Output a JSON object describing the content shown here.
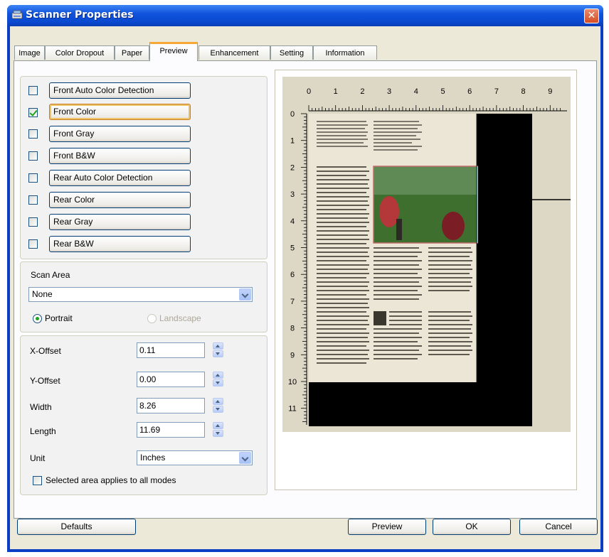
{
  "window": {
    "title": "Scanner Properties",
    "close_label": "✕"
  },
  "tabs": [
    {
      "label": "Image"
    },
    {
      "label": "Color Dropout"
    },
    {
      "label": "Paper"
    },
    {
      "label": "Preview",
      "active": true
    },
    {
      "label": "Enhancement"
    },
    {
      "label": "Setting"
    },
    {
      "label": "Information"
    }
  ],
  "image_modes": [
    {
      "label": "Front Auto Color Detection",
      "checked": false
    },
    {
      "label": "Front Color",
      "checked": true,
      "focused": true
    },
    {
      "label": "Front Gray",
      "checked": false
    },
    {
      "label": "Front B&W",
      "checked": false
    },
    {
      "label": "Rear Auto Color Detection",
      "checked": false
    },
    {
      "label": "Rear Color",
      "checked": false
    },
    {
      "label": "Rear Gray",
      "checked": false
    },
    {
      "label": "Rear B&W",
      "checked": false
    }
  ],
  "scan_area": {
    "label": "Scan Area",
    "value": "None",
    "portrait_label": "Portrait",
    "landscape_label": "Landscape",
    "orientation": "portrait"
  },
  "offsets": {
    "x_offset": {
      "label": "X-Offset",
      "value": "0.11"
    },
    "y_offset": {
      "label": "Y-Offset",
      "value": "0.00"
    },
    "width": {
      "label": "Width",
      "value": "8.26"
    },
    "length": {
      "label": "Length",
      "value": "11.69"
    },
    "unit": {
      "label": "Unit",
      "value": "Inches"
    }
  },
  "apply_all": {
    "label": "Selected area applies to all modes",
    "checked": false
  },
  "ruler": {
    "h_ticks": [
      "0",
      "1",
      "2",
      "3",
      "4",
      "5",
      "6",
      "7",
      "8",
      "9"
    ],
    "v_ticks": [
      "0",
      "1",
      "2",
      "3",
      "4",
      "5",
      "6",
      "7",
      "8",
      "9",
      "10",
      "11"
    ]
  },
  "buttons": {
    "defaults": "Defaults",
    "preview": "Preview",
    "ok": "OK",
    "cancel": "Cancel"
  },
  "colors": {
    "accent_focus": "#f7a839",
    "check_green": "#21a121",
    "titlebar": "#0a49d0",
    "dialog_bg": "#ece9d8"
  }
}
